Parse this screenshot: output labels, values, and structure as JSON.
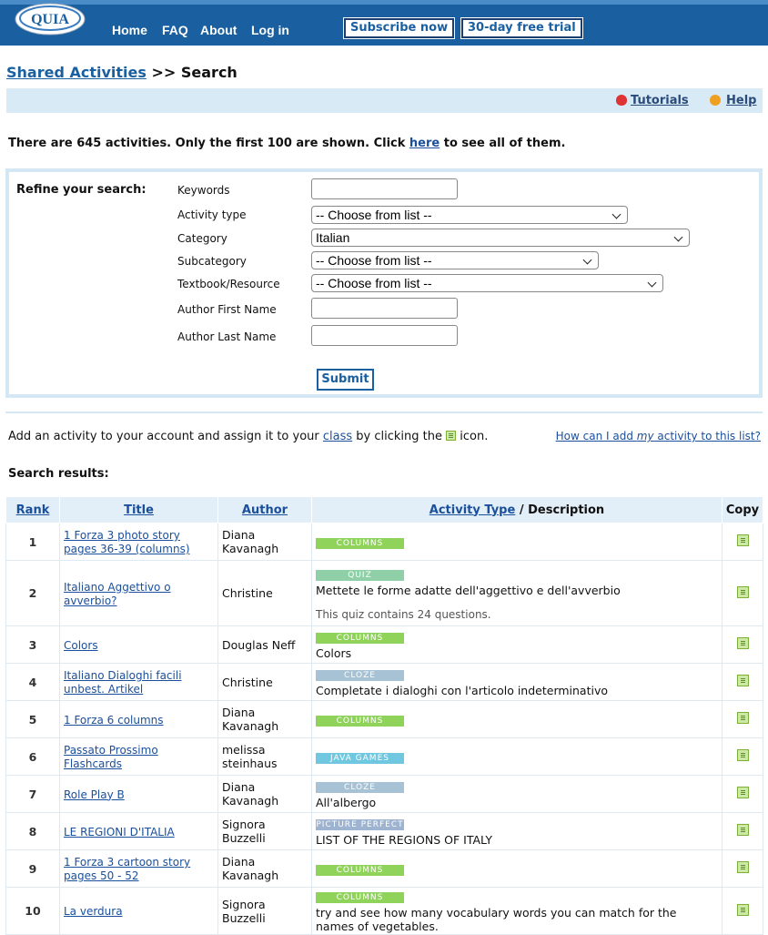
{
  "header": {
    "logo_text": "QUIA",
    "nav": [
      "Home",
      "FAQ",
      "About",
      "Log in"
    ],
    "subscribe": "Subscribe now",
    "trial": "30-day free trial"
  },
  "breadcrumb": {
    "link": "Shared Activities",
    "sep": ">>",
    "current": "Search"
  },
  "toolbar": {
    "tutorials": "Tutorials",
    "help": "Help"
  },
  "summary": {
    "before": "There are 645 activities. Only the first 100 are shown. Click ",
    "link": "here",
    "after": " to see all of them."
  },
  "refine": {
    "heading": "Refine your search:",
    "keywords_label": "Keywords",
    "keywords_value": "",
    "activity_type_label": "Activity type",
    "activity_type_value": "-- Choose from list --",
    "category_label": "Category",
    "category_value": "Italian",
    "subcategory_label": "Subcategory",
    "subcategory_value": "-- Choose from list --",
    "textbook_label": "Textbook/Resource",
    "textbook_value": "-- Choose from list --",
    "first_name_label": "Author First Name",
    "last_name_label": "Author Last Name",
    "submit": "Submit"
  },
  "add_info": {
    "before": "Add an activity to your account and assign it to your ",
    "link": "class",
    "middle": " by clicking the ",
    "after": " icon."
  },
  "how_link": {
    "before": "How can I add ",
    "em": "my",
    "after": " activity to this list?"
  },
  "results_heading": "Search results:",
  "table": {
    "headers": {
      "rank": "Rank",
      "title": "Title",
      "author": "Author",
      "type": "Activity Type",
      "type_sep": " / ",
      "desc": "Description",
      "copy": "Copy"
    },
    "rows": [
      {
        "rank": "1",
        "title": "1 Forza 3 photo story pages 36-39 (columns)",
        "author": "Diana Kavanagh",
        "type": "COLUMNS",
        "desc": "",
        "note": ""
      },
      {
        "rank": "2",
        "title": "Italiano Aggettivo o avverbio?",
        "author": "Christine",
        "type": "QUIZ",
        "desc": "Mettete le forme adatte dell'aggettivo e dell'avverbio",
        "note": "This quiz contains 24 questions."
      },
      {
        "rank": "3",
        "title": "Colors",
        "author": "Douglas Neff",
        "type": "COLUMNS",
        "desc": "Colors",
        "note": ""
      },
      {
        "rank": "4",
        "title": "Italiano Dialoghi facili unbest. Artikel",
        "author": "Christine",
        "type": "CLOZE",
        "desc": "Completate i dialoghi con l'articolo indeterminativo",
        "note": ""
      },
      {
        "rank": "5",
        "title": "1 Forza 6 columns",
        "author": "Diana Kavanagh",
        "type": "COLUMNS",
        "desc": "",
        "note": ""
      },
      {
        "rank": "6",
        "title": "Passato Prossimo Flashcards",
        "author": "melissa steinhaus",
        "type": "JAVA GAMES",
        "desc": "",
        "note": ""
      },
      {
        "rank": "7",
        "title": "Role Play B",
        "author": "Diana Kavanagh",
        "type": "CLOZE",
        "desc": "All'albergo",
        "note": ""
      },
      {
        "rank": "8",
        "title": "LE REGIONI D'ITALIA",
        "author": "Signora Buzzelli",
        "type": "PICTURE PERFECT",
        "desc": "LIST OF THE REGIONS OF ITALY",
        "note": ""
      },
      {
        "rank": "9",
        "title": "1 Forza 3 cartoon story pages 50 - 52",
        "author": "Diana Kavanagh",
        "type": "COLUMNS",
        "desc": "",
        "note": ""
      },
      {
        "rank": "10",
        "title": "La verdura",
        "author": "Signora Buzzelli",
        "type": "COLUMNS",
        "desc": "try and see how many vocabulary words you can match for the names of vegetables.",
        "note": ""
      }
    ]
  },
  "type_colors": {
    "COLUMNS": "#8fd35a",
    "QUIZ": "#8fd0a8",
    "CLOZE": "#a6c2d4",
    "JAVA GAMES": "#6fc8e0",
    "PICTURE PERFECT": "#9db3cf"
  }
}
